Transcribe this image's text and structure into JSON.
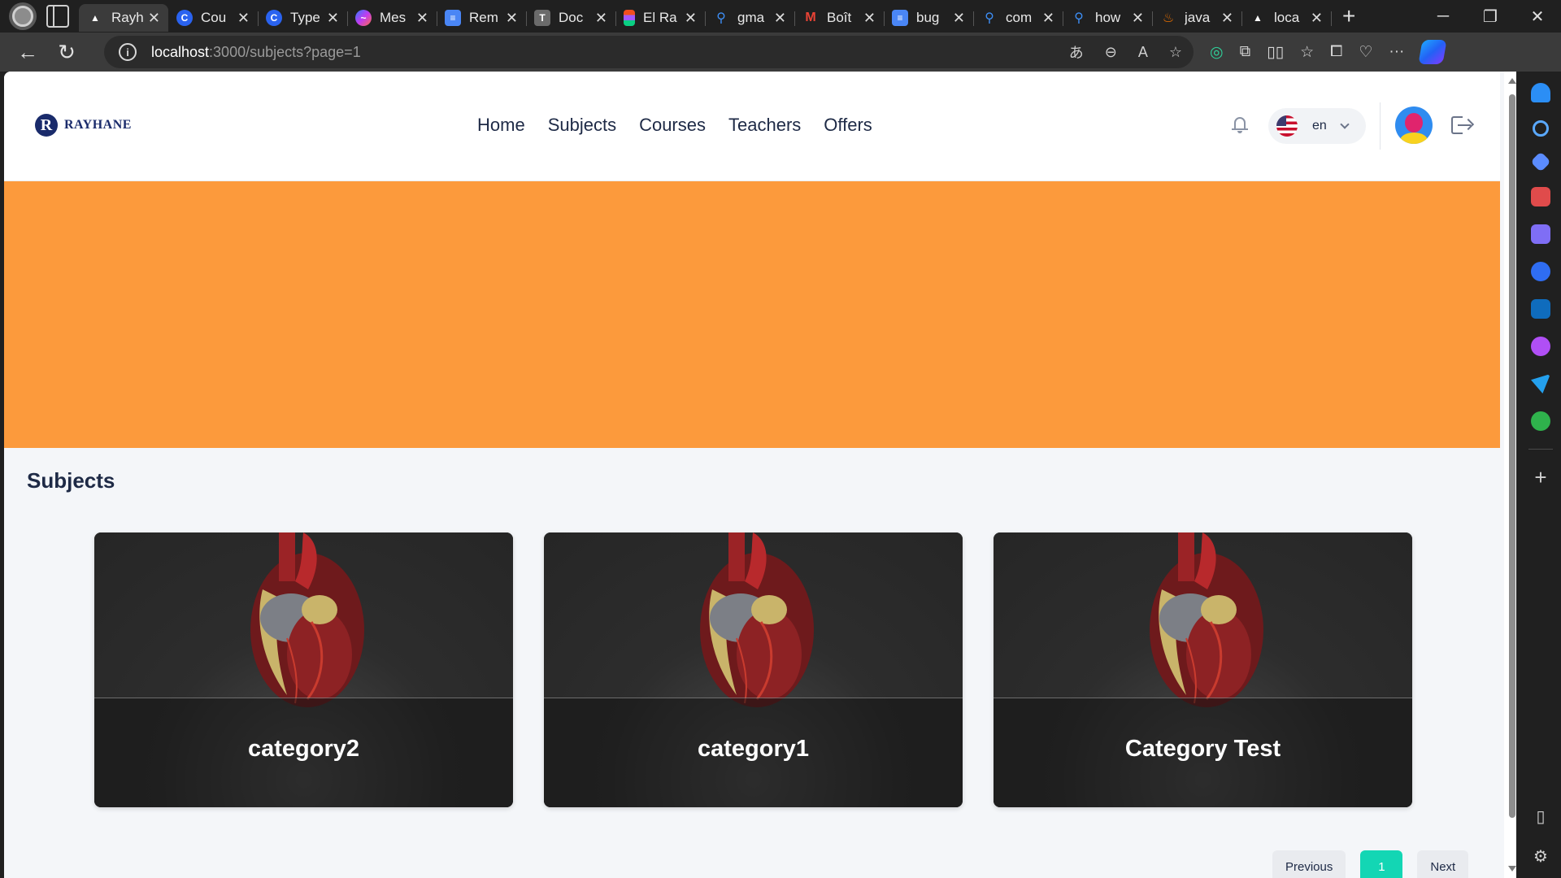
{
  "browser": {
    "tabs": [
      {
        "label": "Rayh",
        "icon": "vercel-icon",
        "icon_color": "#ffffff",
        "active": true
      },
      {
        "label": "Cou",
        "icon": "c-icon",
        "icon_color": "#2a63f0"
      },
      {
        "label": "Type",
        "icon": "c-icon",
        "icon_color": "#2a63f0"
      },
      {
        "label": "Mes",
        "icon": "messenger-icon",
        "icon_color": "#a34cf0"
      },
      {
        "label": "Rem",
        "icon": "docs-icon",
        "icon_color": "#4a86f5"
      },
      {
        "label": "Doc",
        "icon": "doc-icon",
        "icon_color": "#6b6b6b"
      },
      {
        "label": "El Ra",
        "icon": "figma-icon",
        "icon_color": "#f24e1e"
      },
      {
        "label": "gma",
        "icon": "search-icon",
        "icon_color": "#3d8ef5"
      },
      {
        "label": "Boît",
        "icon": "gmail-icon",
        "icon_color": "#ea4335"
      },
      {
        "label": "bug",
        "icon": "docs-icon",
        "icon_color": "#4a86f5"
      },
      {
        "label": "com",
        "icon": "search-icon",
        "icon_color": "#3d8ef5"
      },
      {
        "label": "how",
        "icon": "search-icon",
        "icon_color": "#3d8ef5"
      },
      {
        "label": "java",
        "icon": "java-icon",
        "icon_color": "#e76f00"
      },
      {
        "label": "loca",
        "icon": "vercel-icon",
        "icon_color": "#ffffff"
      }
    ],
    "url_host": "localhost",
    "url_rest": ":3000/subjects?page=1"
  },
  "site": {
    "logo_text": "RAYHANE",
    "logo_letter": "R",
    "nav": [
      "Home",
      "Subjects",
      "Courses",
      "Teachers",
      "Offers"
    ],
    "language": "en",
    "hero_color": "#fc9a3c",
    "accent_color": "#13d6b4"
  },
  "subjects": {
    "title": "Subjects",
    "cards": [
      {
        "title": "category2"
      },
      {
        "title": "category1"
      },
      {
        "title": "Category Test"
      }
    ]
  },
  "pagination": {
    "previous": "Previous",
    "current": "1",
    "next": "Next"
  }
}
